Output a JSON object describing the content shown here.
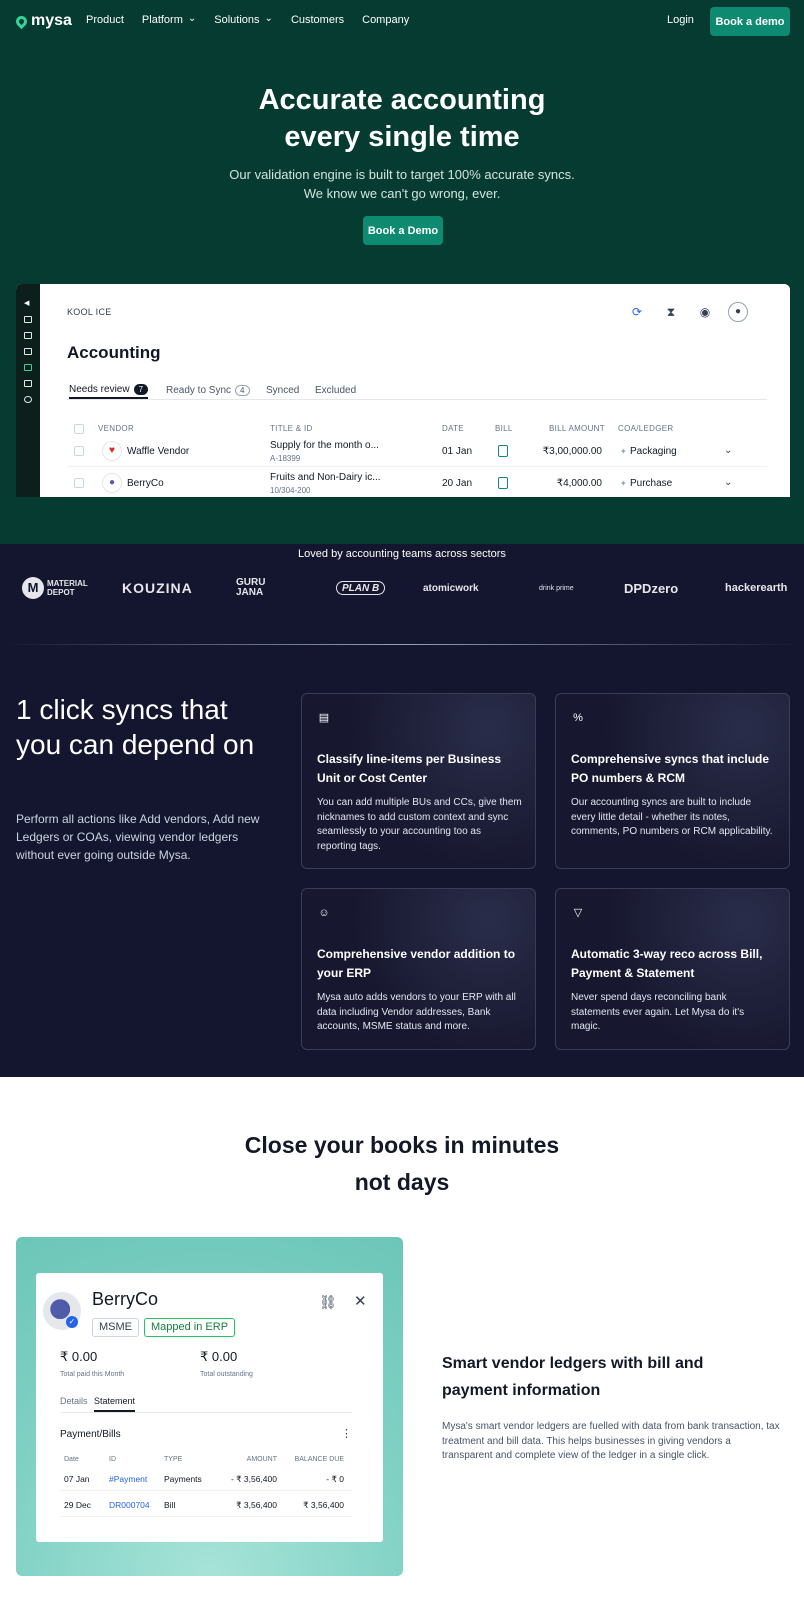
{
  "nav": {
    "brand": "mysa",
    "links": [
      "Product",
      "Platform",
      "Solutions",
      "Customers",
      "Company"
    ],
    "login": "Login",
    "cta": "Book a demo"
  },
  "hero": {
    "title": "Accurate accounting\nevery single time",
    "subtitle": "Our validation engine is built to target 100% accurate syncs.\nWe know we can't go wrong, ever.",
    "cta": "Book a Demo"
  },
  "app": {
    "company": "KOOL ICE",
    "title": "Accounting",
    "tabs": [
      {
        "label": "Needs review",
        "count": "7"
      },
      {
        "label": "Ready to Sync",
        "count": "4"
      },
      {
        "label": "Synced",
        "count": ""
      },
      {
        "label": "Excluded",
        "count": ""
      }
    ],
    "columns": [
      "VENDOR",
      "TITLE & ID",
      "DATE",
      "BILL",
      "BILL AMOUNT",
      "COA/LEDGER"
    ],
    "rows": [
      {
        "vendor": "Waffle Vendor",
        "title": "Supply for the month o...",
        "id": "A-18399",
        "date": "01 Jan",
        "amount": "₹3,00,000.00",
        "ledger": "Packaging"
      },
      {
        "vendor": "BerryCo",
        "title": "Fruits and Non-Dairy ic...",
        "id": "10/304-200",
        "date": "20 Jan",
        "amount": "₹4,000.00",
        "ledger": "Purchase"
      }
    ]
  },
  "logos": {
    "title": "Loved by accounting teams across sectors",
    "items": [
      "MATERIAL DEPOT",
      "KOUZINA",
      "GURU JANA",
      "PLAN B",
      "atomicwork",
      "drink prime",
      "DPDzero",
      "hackerearth"
    ]
  },
  "features": {
    "title": "1 click syncs that you can depend on",
    "description": "Perform all actions like Add vendors, Add new Ledgers or COAs, viewing vendor ledgers without ever going outside Mysa.",
    "cards": [
      {
        "icon": "document-icon",
        "title": "Classify line-items per Business Unit or Cost Center",
        "desc": "You can add multiple BUs and CCs, give them nicknames to add custom context and sync seamlessly to your accounting too as reporting tags."
      },
      {
        "icon": "percent-icon",
        "title": "Comprehensive syncs that include PO numbers & RCM",
        "desc": "Our accounting syncs are built to include every little detail - whether its notes, comments, PO numbers or RCM applicability."
      },
      {
        "icon": "users-icon",
        "title": "Comprehensive vendor addition to your ERP",
        "desc": "Mysa auto adds vendors to your ERP with all data including Vendor addresses, Bank accounts, MSME status and more."
      },
      {
        "icon": "filter-icon",
        "title": "Automatic 3-way reco across Bill, Payment & Statement",
        "desc": "Never spend days reconciling bank statements ever again. Let Mysa do it's magic."
      }
    ]
  },
  "close": {
    "title": "Close your books in minutes\nnot days"
  },
  "ledger": {
    "name": "BerryCo",
    "tag_msme": "MSME",
    "tag_erp": "Mapped in ERP",
    "paid_value": "₹ 0.00",
    "paid_label": "Total paid this Month",
    "outstanding_value": "₹ 0.00",
    "outstanding_label": "Total outstanding",
    "tabs": [
      "Details",
      "Statement"
    ],
    "section": "Payment/Bills",
    "columns": [
      "Date",
      "ID",
      "TYPE",
      "AMOUNT",
      "BALANCE DUE"
    ],
    "rows": [
      {
        "date": "07 Jan",
        "id": "#Payment",
        "type": "Payments",
        "amount": "- ₹ 3,56,400",
        "balance": "- ₹ 0"
      },
      {
        "date": "29 Dec",
        "id": "DR000704",
        "type": "Bill",
        "amount": "₹ 3,56,400",
        "balance": "₹ 3,56,400"
      }
    ]
  },
  "smart": {
    "title": "Smart vendor ledgers with bill and payment information",
    "desc": "Mysa's smart vendor ledgers are fuelled with data from bank transaction, tax treatment and bill data. This helps businesses in giving vendors a transparent and complete view of the ledger in a single click."
  }
}
